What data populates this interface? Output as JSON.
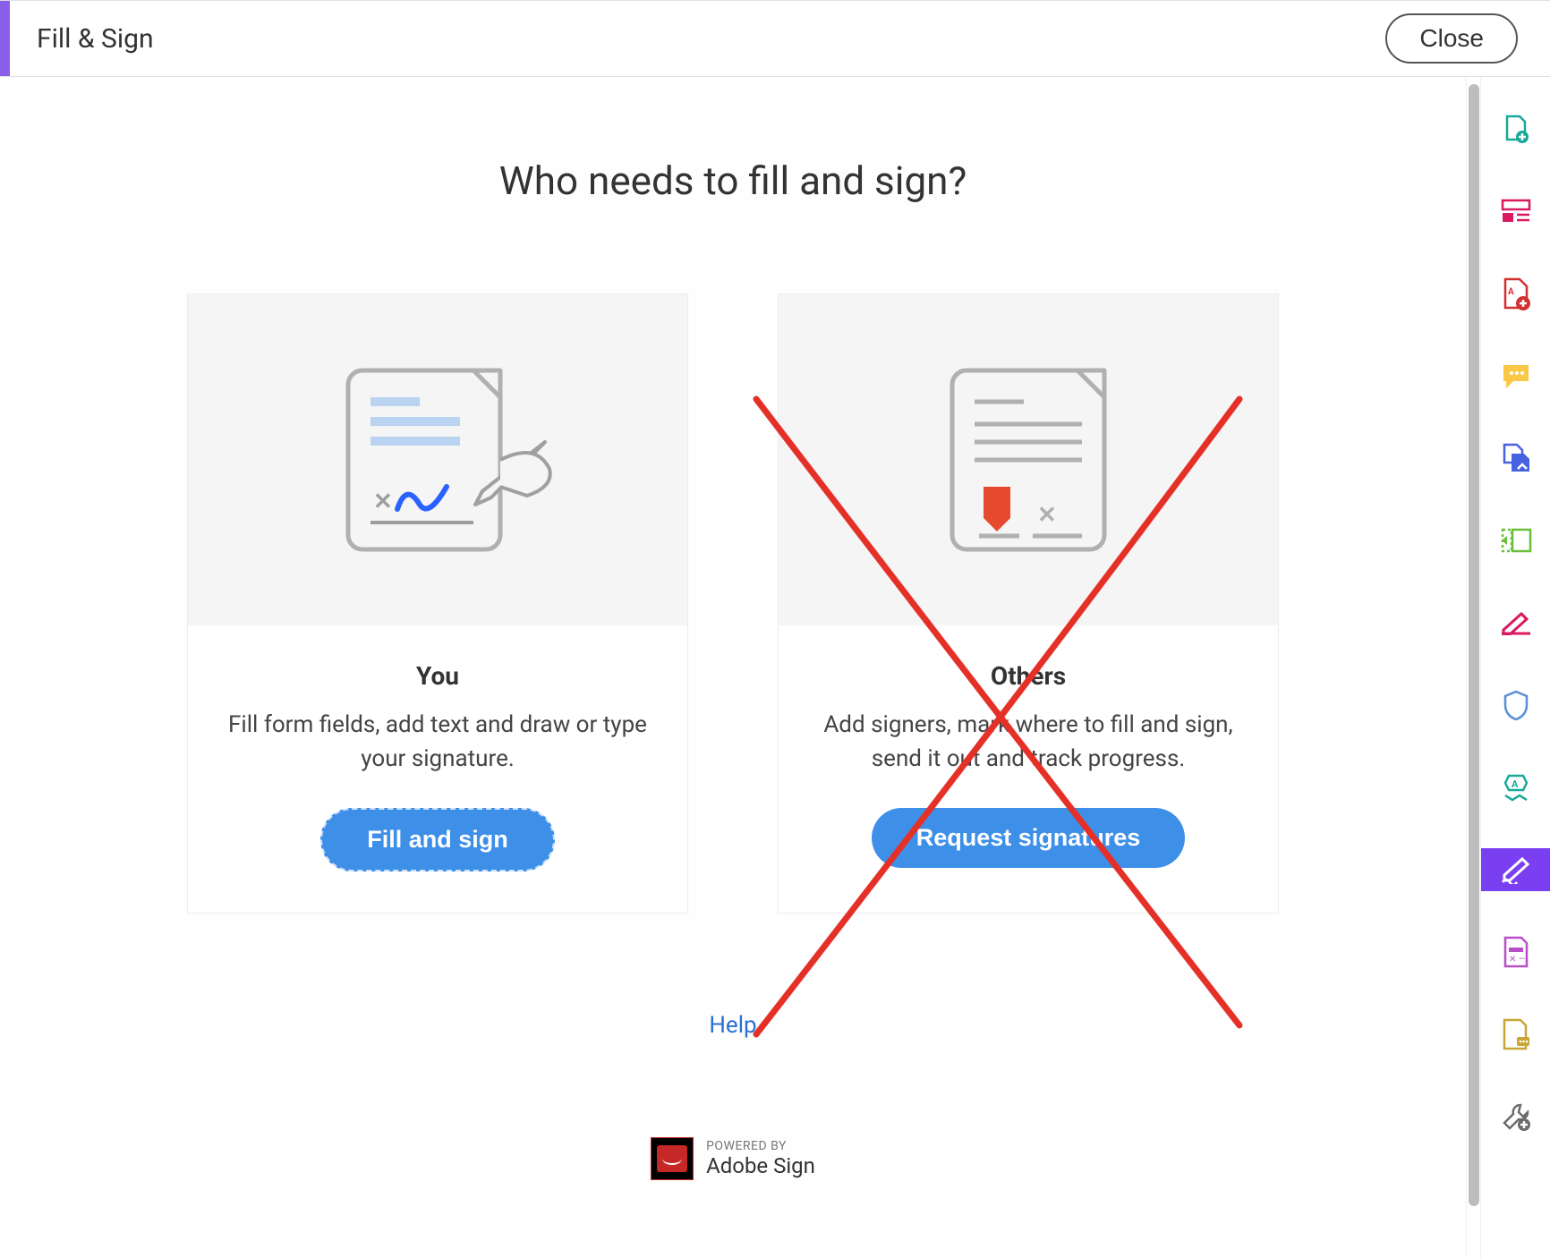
{
  "header": {
    "title": "Fill & Sign",
    "close_label": "Close"
  },
  "main": {
    "title": "Who needs to fill and sign?",
    "help_label": "Help",
    "powered_label": "POWERED BY",
    "powered_brand": "Adobe Sign"
  },
  "cards": {
    "you": {
      "title": "You",
      "desc": "Fill form fields, add text and draw or type your signature.",
      "button": "Fill and sign"
    },
    "others": {
      "title": "Others",
      "desc": "Add signers, mark where to fill and sign, send it out and track progress.",
      "button": "Request signatures"
    }
  },
  "sidebar": {
    "icons": [
      "export-pdf-icon",
      "organize-icon",
      "create-pdf-icon",
      "comment-icon",
      "combine-icon",
      "compress-icon",
      "sign-icon",
      "protect-icon",
      "stamp-icon",
      "fill-sign-icon",
      "redact-icon",
      "send-icon",
      "more-tools-icon"
    ],
    "active_index": 9
  },
  "annotation": {
    "x_overlay_on": "others"
  }
}
